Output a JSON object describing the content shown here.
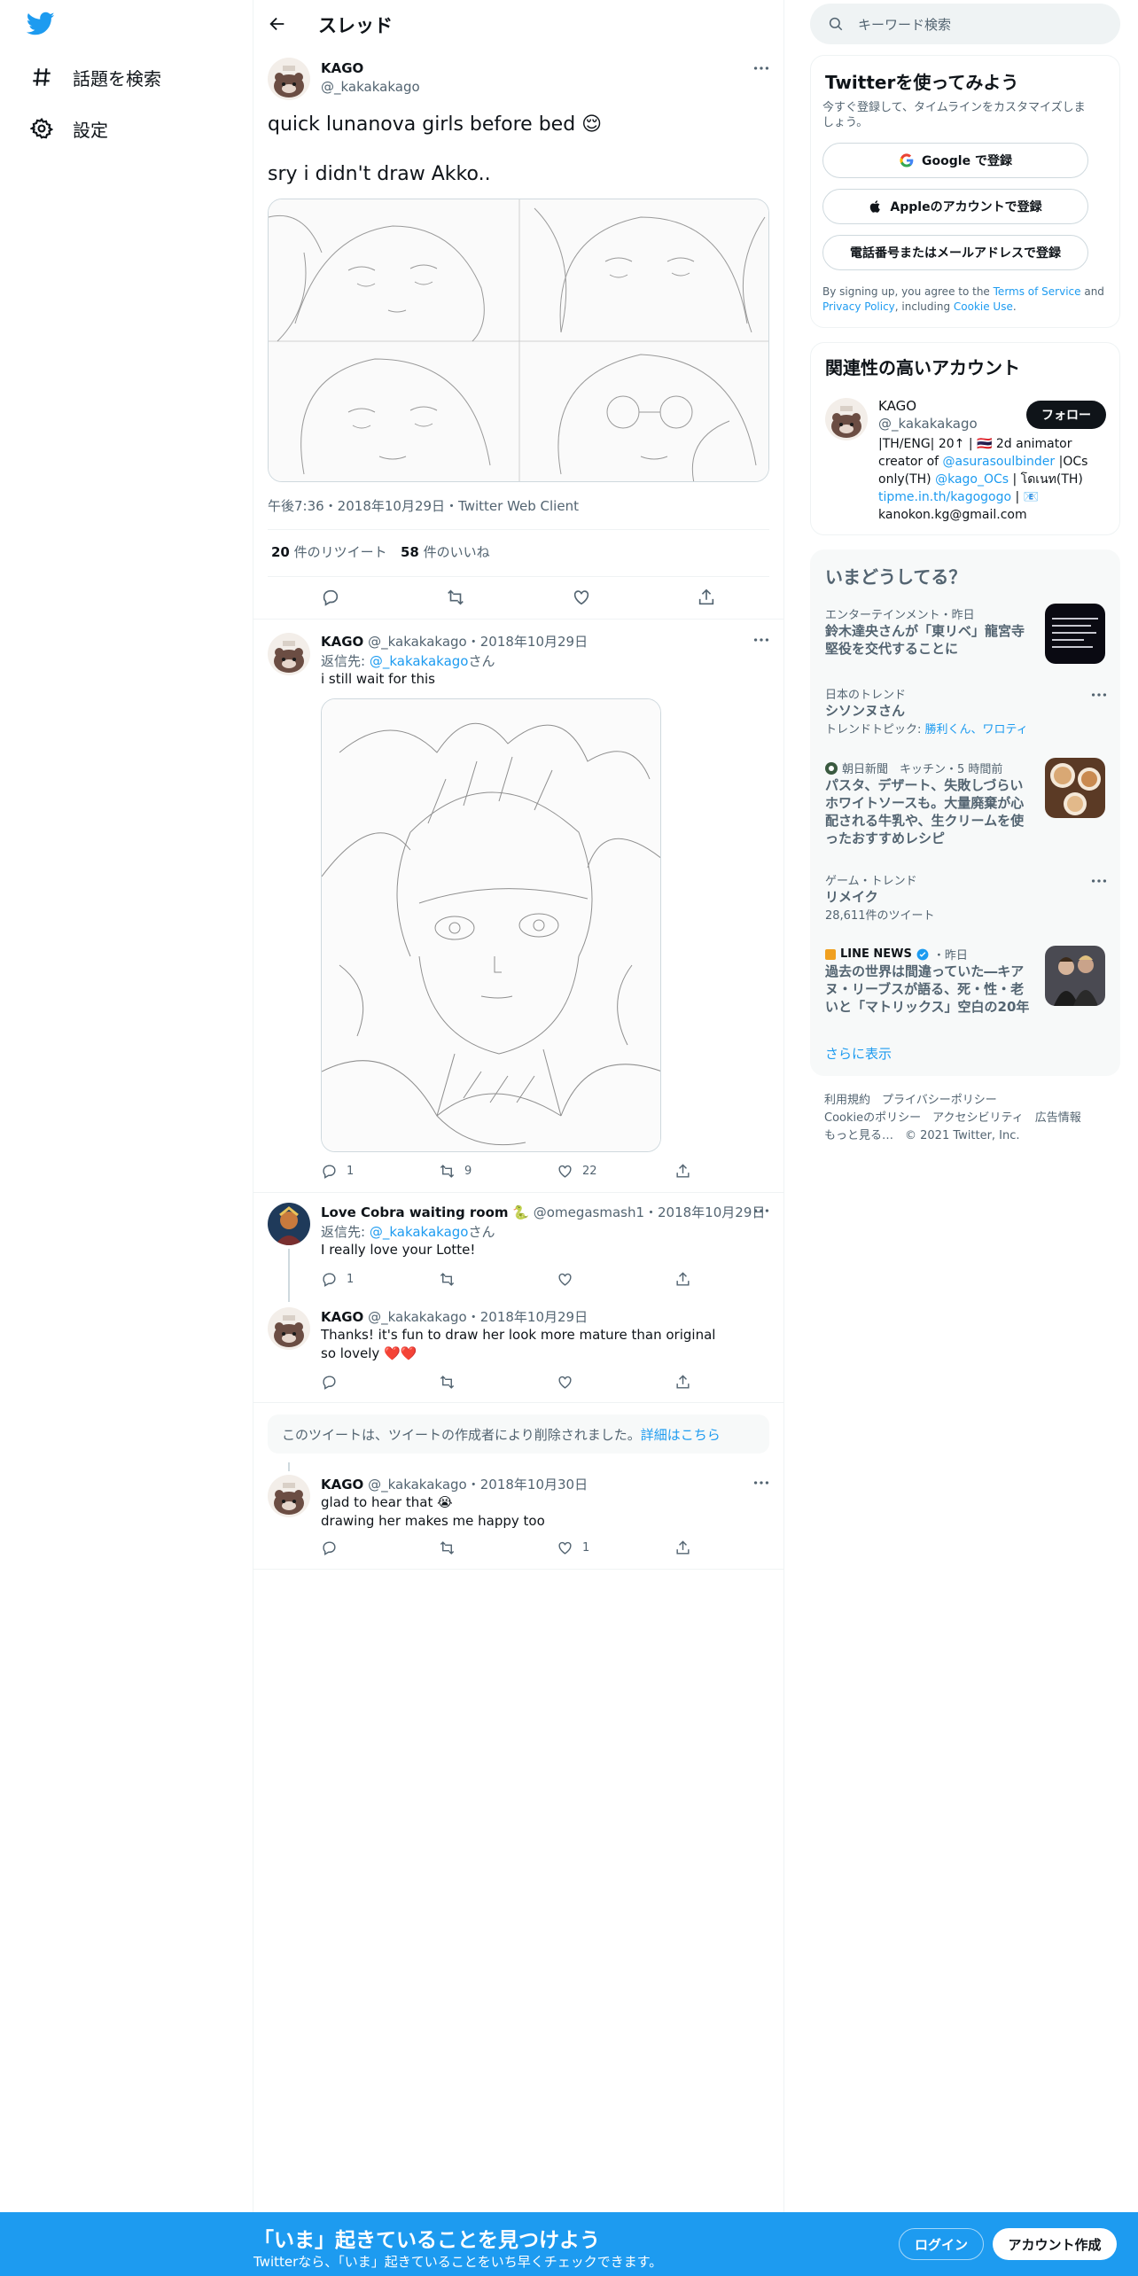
{
  "nav": {
    "items": [
      {
        "label": "話題を検索",
        "icon": "hashtag-icon"
      },
      {
        "label": "設定",
        "icon": "gear-icon"
      }
    ]
  },
  "header": {
    "title": "スレッド"
  },
  "main_tweet": {
    "name": "KAGO",
    "handle": "@_kakakakago",
    "line1": "quick lunanova girls before bed 😌",
    "line2": "sry i didn't draw Akko..",
    "timestamp": "午後7:36・2018年10月29日・Twitter Web Client",
    "retweets_count": "20",
    "retweets_label": "件のリツイート",
    "likes_count": "58",
    "likes_label": "件のいいね"
  },
  "replies": [
    {
      "name": "KAGO",
      "meta": "@_kakakakago・2018年10月29日",
      "reply_prefix": "返信先: ",
      "reply_to": "@_kakakakago",
      "reply_suffix": "さん",
      "text": "i still wait for this",
      "reply_count": "1",
      "retweet_count": "9",
      "like_count": "22"
    },
    {
      "name": "Love Cobra waiting room",
      "meta": "@omegasmash1・2018年10月29日",
      "reply_prefix": "返信先: ",
      "reply_to": "@_kakakakago",
      "reply_suffix": "さん",
      "text": "I really love your Lotte!",
      "reply_count": "1"
    },
    {
      "name": "KAGO",
      "meta": "@_kakakakago・2018年10月29日",
      "text1": "Thanks! it's fun to draw her look more mature than original",
      "text2": "so lovely ❤️❤️"
    },
    {
      "name": "KAGO",
      "meta": "@_kakakakago・2018年10月30日",
      "text1": "glad to hear that 😭",
      "text2": "drawing her makes me happy too",
      "like_count": "1"
    }
  ],
  "deleted": {
    "text": "このツイートは、ツイートの作成者により削除されました。",
    "link": "詳細はこちら"
  },
  "search": {
    "placeholder": "キーワード検索"
  },
  "signup_card": {
    "title": "Twitterを使ってみよう",
    "subtitle1": "今すぐ登録して、タイムラインをカスタマイズしま",
    "subtitle2": "しょう。",
    "google": "Google で登録",
    "apple": "Appleのアカウントで登録",
    "phone": "電話番号またはメールアドレスで登録",
    "terms_pre": "By signing up, you agree to the ",
    "terms_link": "Terms of Service",
    "terms_and": " and",
    "privacy_link": "Privacy Policy",
    "terms_including": ", including ",
    "cookie_link": "Cookie Use",
    "terms_end": "."
  },
  "related": {
    "title": "関連性の高いアカウント",
    "name": "KAGO",
    "handle": "@_kakakakago",
    "follow": "フォロー",
    "bio1": "|TH/ENG| 20↑ | 🇹🇭 2d animator",
    "bio2_pre": "creator of ",
    "bio2_link": "@asurasoulbinder",
    "bio2_post": " |OCs",
    "bio3_pre": "only(TH) ",
    "bio3_link": "@kago_OCs",
    "bio3_post": " | โดเนท(TH)",
    "bio4_link": "tipme.in.th/kagogogo",
    "bio4_post": " | 📧",
    "bio5": "kanokon.kg@gmail.com"
  },
  "trends": {
    "title": "いまどうしてる？",
    "items": [
      {
        "meta": "エンターテインメント・昨日",
        "title1": "鈴木達央さんが「東リベ」龍宮寺",
        "title2": "堅役を交代することに"
      },
      {
        "meta": "日本のトレンド",
        "title1": "シソンヌさん",
        "sub_pre": "トレンドトピック: ",
        "sub_link": "勝利くん、ワロティ"
      },
      {
        "source": "朝日新聞　キッチン・5 時間前",
        "title1": "パスタ、デザート、失敗しづらい",
        "title2": "ホワイトソースも。大量廃棄が心",
        "title3": "配される牛乳や、生クリームを使",
        "title4": "ったおすすめレシピ"
      },
      {
        "meta": "ゲーム・トレンド",
        "title1": "リメイク",
        "count": "28,611件のツイート"
      },
      {
        "source": "LINE NEWS",
        "source_time": "・昨日",
        "title1": "過去の世界は間違っていた―キア",
        "title2": "ヌ・リーブスが語る、死・性・老",
        "title3": "いと「マトリックス」空白の20年"
      }
    ],
    "more": "さらに表示"
  },
  "footer": {
    "line1": "利用規約　プライバシーポリシー",
    "line2": "Cookieのポリシー　アクセシビリティ　広告情報",
    "line3": "もっと見る…　© 2021 Twitter, Inc."
  },
  "bottom_bar": {
    "title": "「いま」起きていることを見つけよう",
    "subtitle": "Twitterなら、「いま」起きていることをいち早くチェックできます。",
    "login": "ログイン",
    "signup": "アカウント作成"
  },
  "colors": {
    "brand": "#1d9bf0",
    "text": "#0f1419",
    "secondary": "#536471",
    "border": "#eff3f4"
  }
}
